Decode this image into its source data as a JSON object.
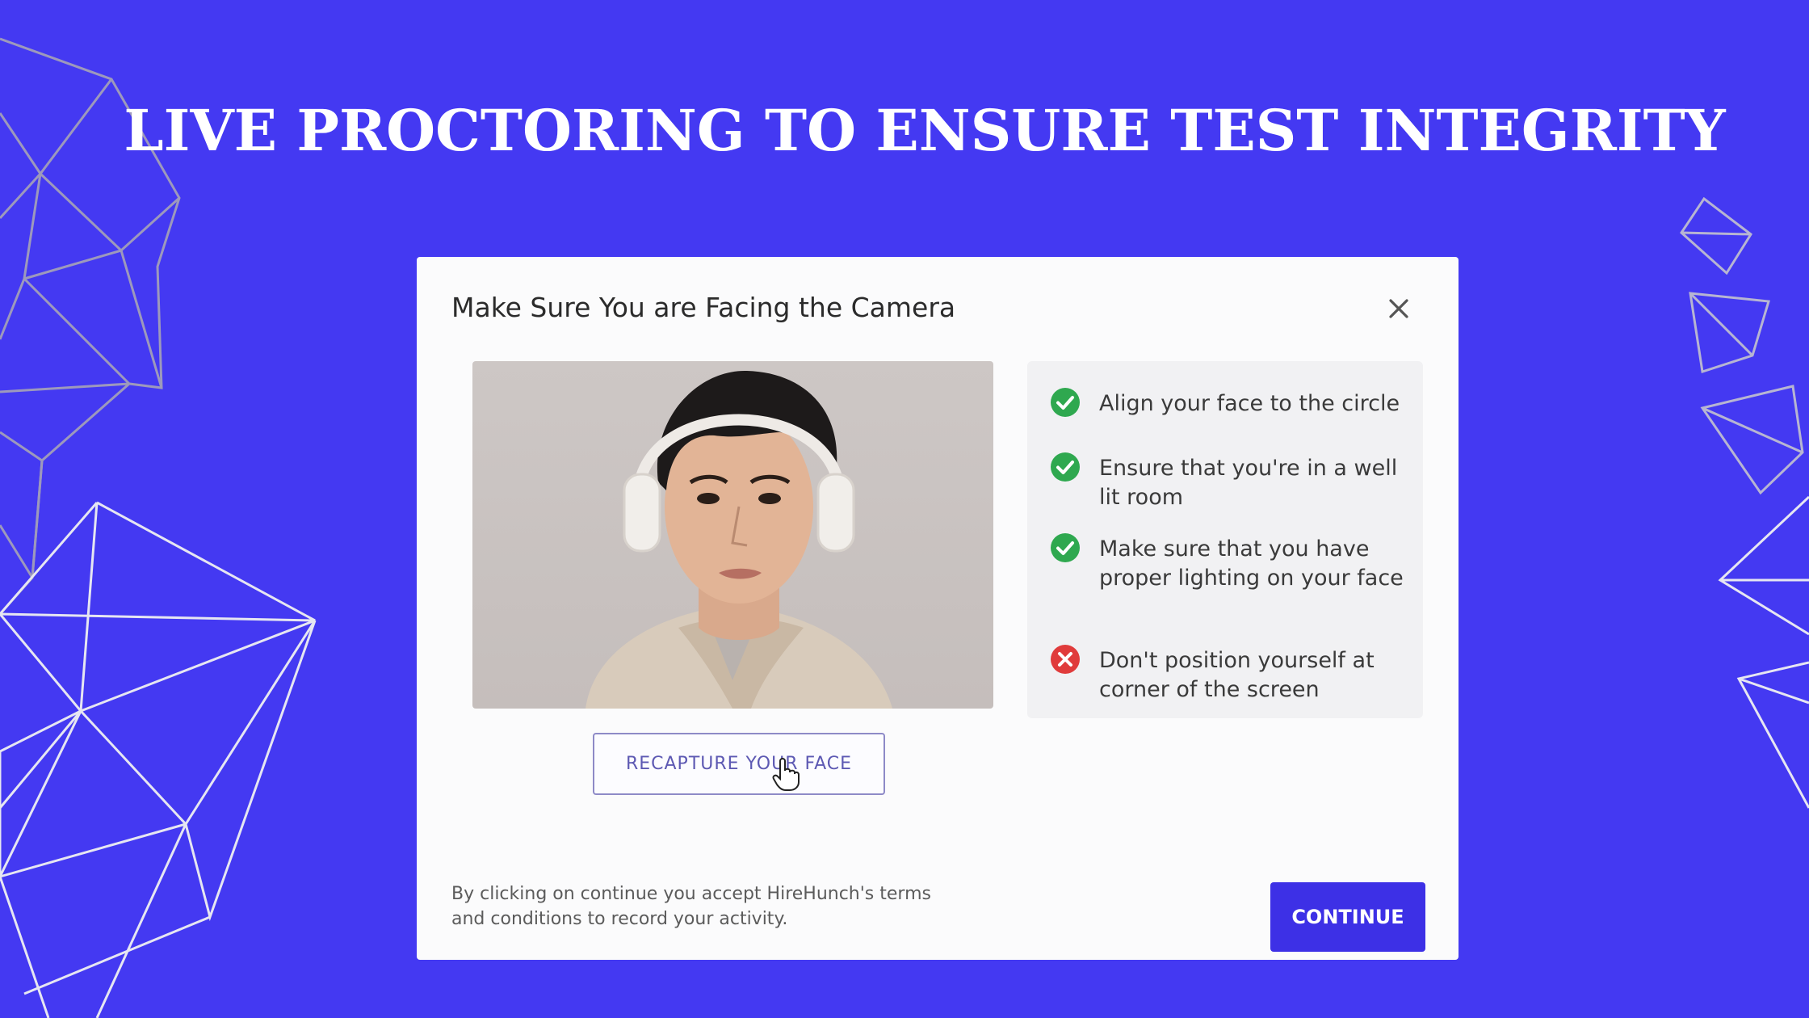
{
  "headline": "LIVE PROCTORING TO ENSURE TEST INTEGRITY",
  "modal": {
    "title": "Make Sure You are Facing the Camera",
    "close_icon": "close-icon",
    "recapture_label": "RECAPTURE YOUR FACE",
    "checklist": [
      {
        "text": "Align your face to the circle",
        "status": "ok"
      },
      {
        "text": "Ensure that you're in a well lit room",
        "status": "ok"
      },
      {
        "text": "Make sure that you have proper lighting on your face",
        "status": "ok"
      },
      {
        "text": "Don't position yourself at corner of the screen",
        "status": "error"
      }
    ],
    "terms": "By clicking on continue you accept HireHunch's terms and conditions to record your activity.",
    "continue_label": "CONTINUE"
  },
  "colors": {
    "background": "#4439f2",
    "ok": "#2fa84f",
    "error": "#e03b3b",
    "primary": "#3d30e6"
  }
}
